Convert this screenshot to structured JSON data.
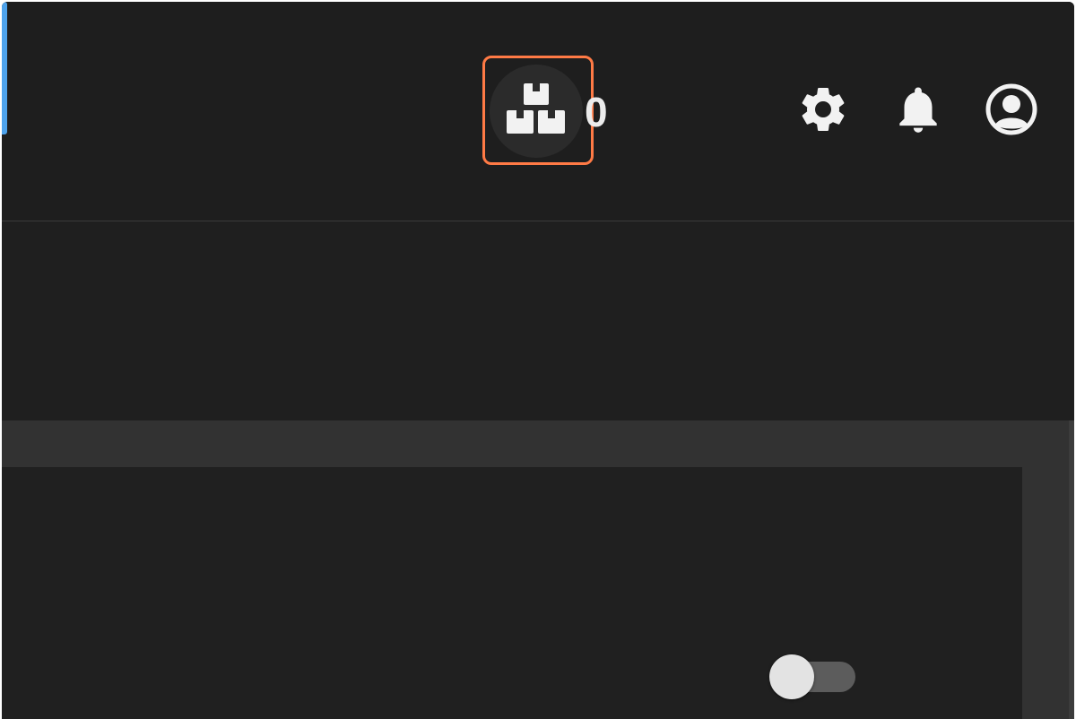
{
  "colors": {
    "accent_blue": "#4ea3ec",
    "highlight_orange": "#ff7a45",
    "icon_white": "#f2f2f2",
    "background": "#1f1f1f"
  },
  "header": {
    "packages_button": {
      "icon": "packages-icon",
      "count": "0"
    },
    "settings_button": {
      "icon": "gear-icon"
    },
    "notifications_button": {
      "icon": "bell-icon"
    },
    "account_button": {
      "icon": "account-circle-icon"
    }
  },
  "main": {
    "toggle": {
      "state": "off"
    }
  }
}
